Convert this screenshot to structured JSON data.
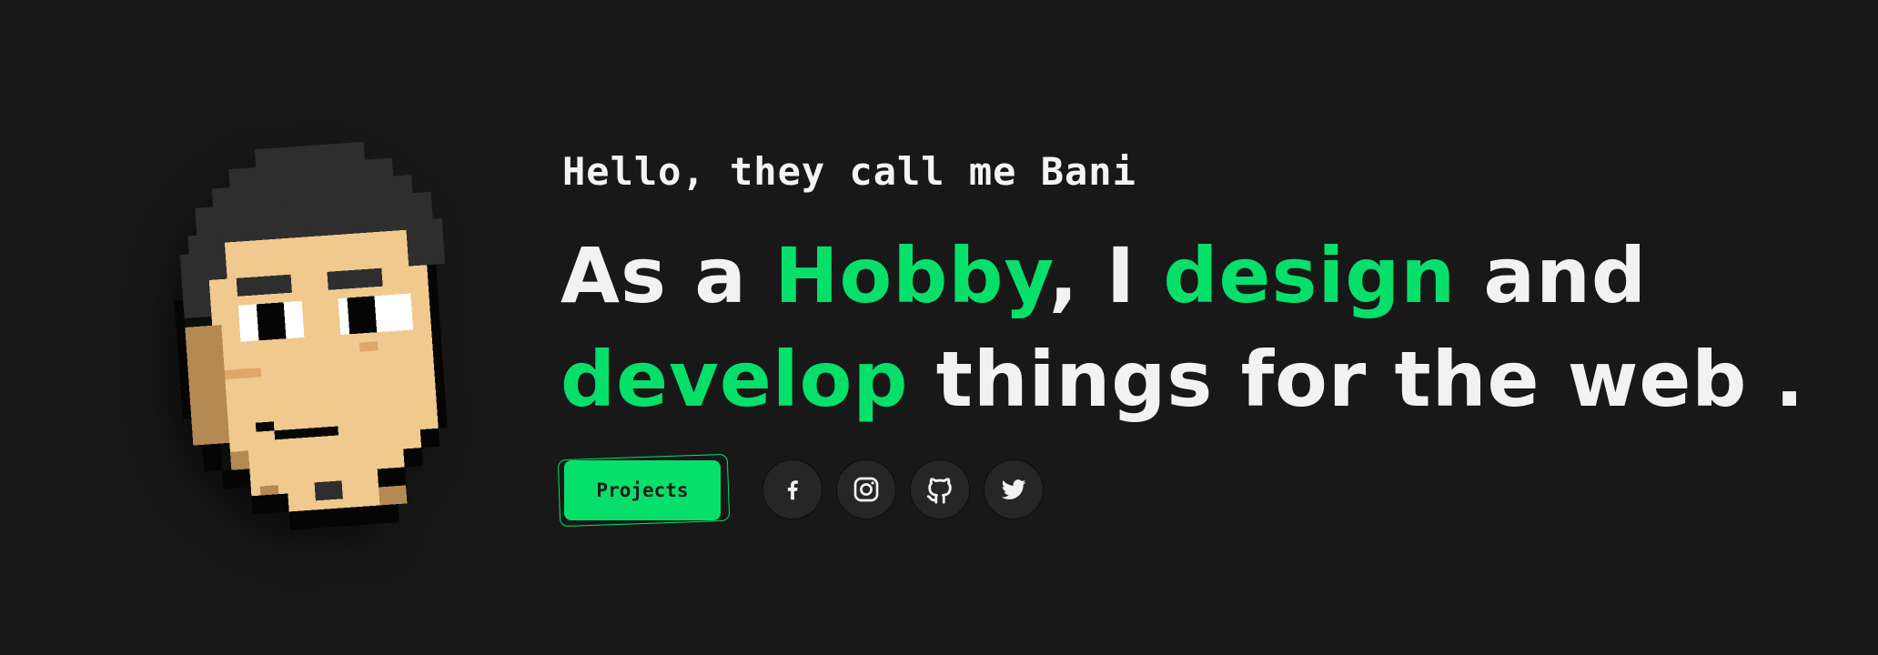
{
  "greeting": "Hello, they call me Bani",
  "headline": {
    "line1": [
      {
        "text": "As a ",
        "accent": false
      },
      {
        "text": "Hobby",
        "accent": true
      },
      {
        "text": ", I ",
        "accent": false
      },
      {
        "text": "design",
        "accent": true
      },
      {
        "text": " and",
        "accent": false
      }
    ],
    "line2": [
      {
        "text": "develop",
        "accent": true
      },
      {
        "text": " things for the web .",
        "accent": false
      }
    ]
  },
  "cta": {
    "label": "Projects"
  },
  "socials": [
    {
      "name": "facebook",
      "icon": "facebook-icon"
    },
    {
      "name": "instagram",
      "icon": "instagram-icon"
    },
    {
      "name": "github",
      "icon": "github-icon"
    },
    {
      "name": "twitter",
      "icon": "twitter-icon"
    }
  ],
  "colors": {
    "background": "#181818",
    "accent": "#06e06a",
    "text": "#f2f2f2",
    "skin": "#f0c98e",
    "hair": "#2e2e2e"
  }
}
